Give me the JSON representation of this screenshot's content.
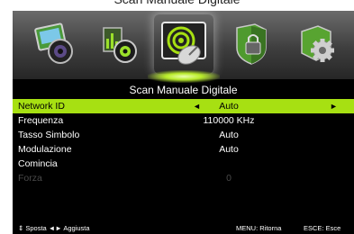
{
  "caption": "Scan Manuale Digitale",
  "menu": {
    "icons": [
      {
        "name": "picture-icon",
        "selected": false
      },
      {
        "name": "sound-icon",
        "selected": false
      },
      {
        "name": "channel-icon",
        "selected": true
      },
      {
        "name": "lock-icon",
        "selected": false
      },
      {
        "name": "setup-icon",
        "selected": false
      }
    ]
  },
  "screen": {
    "title": "Scan Manuale Digitale",
    "rows": [
      {
        "label": "Network ID",
        "value": "Auto",
        "state": "highlighted"
      },
      {
        "label": "Frequenza",
        "value": "110000 KHz",
        "state": "normal"
      },
      {
        "label": "Tasso Simbolo",
        "value": "Auto",
        "state": "normal"
      },
      {
        "label": "Modulazione",
        "value": "Auto",
        "state": "normal"
      },
      {
        "label": "Comincia",
        "value": "",
        "state": "normal"
      },
      {
        "label": "Forza",
        "value": "0",
        "state": "disabled"
      }
    ],
    "arrow_left": "◄",
    "arrow_right": "►"
  },
  "footer": {
    "navigate_hint": "Sposta ◄► Aggiusta",
    "menu_hint": "MENU: Ritorna",
    "exit_hint": "ESCE: Esce"
  },
  "colors": {
    "highlight": "#a7e012",
    "selected_glow": "#b9ec2a",
    "background": "#000000"
  }
}
